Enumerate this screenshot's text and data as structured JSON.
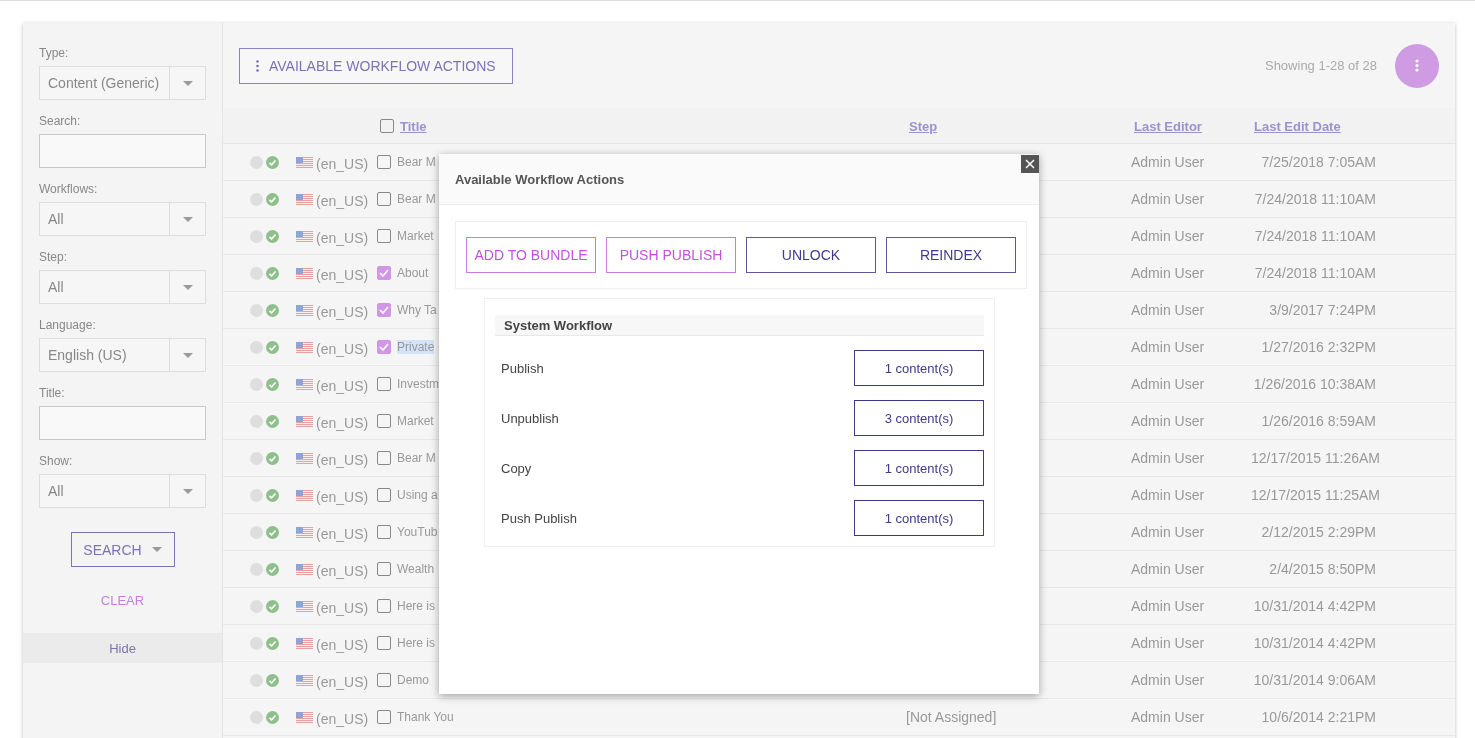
{
  "filters": [
    {
      "label": "Type:",
      "kind": "select",
      "value": "Content (Generic)"
    },
    {
      "label": "Search:",
      "kind": "text"
    },
    {
      "label": "Workflows:",
      "kind": "select",
      "value": "All"
    },
    {
      "label": "Step:",
      "kind": "select",
      "value": "All"
    },
    {
      "label": "Language:",
      "kind": "select",
      "value": "English (US)"
    },
    {
      "label": "Title:",
      "kind": "text"
    },
    {
      "label": "Show:",
      "kind": "select",
      "value": "All"
    }
  ],
  "search_button": "SEARCH",
  "clear_link": "CLEAR",
  "hide_link": "Hide",
  "toolbar": {
    "actions_button": "AVAILABLE WORKFLOW ACTIONS",
    "showing": "Showing 1-28 of 28"
  },
  "table": {
    "select_all": false,
    "columns": [
      "Title",
      "Step",
      "Last Editor",
      "Last Edit Date"
    ],
    "rows": [
      {
        "language": "(en_US)",
        "checked": false,
        "title": "Bear M",
        "editor": "Admin User",
        "date": "7/25/2018 7:05AM"
      },
      {
        "language": "(en_US)",
        "checked": false,
        "title": "Bear M",
        "editor": "Admin User",
        "date": "7/24/2018 11:10AM"
      },
      {
        "language": "(en_US)",
        "checked": false,
        "title": "Market",
        "editor": "Admin User",
        "date": "7/24/2018 11:10AM"
      },
      {
        "language": "(en_US)",
        "checked": true,
        "title": "About",
        "editor": "Admin User",
        "date": "7/24/2018 11:10AM"
      },
      {
        "language": "(en_US)",
        "checked": true,
        "title": "Why Ta",
        "editor": "Admin User",
        "date": "3/9/2017 7:24PM"
      },
      {
        "language": "(en_US)",
        "checked": true,
        "title": "Private",
        "highlighted": true,
        "editor": "Admin User",
        "date": "1/27/2016 2:32PM"
      },
      {
        "language": "(en_US)",
        "checked": false,
        "title": "Investm",
        "editor": "Admin User",
        "date": "1/26/2016 10:38AM"
      },
      {
        "language": "(en_US)",
        "checked": false,
        "title": "Market",
        "editor": "Admin User",
        "date": "1/26/2016 8:59AM"
      },
      {
        "language": "(en_US)",
        "checked": false,
        "title": "Bear M",
        "editor": "Admin User",
        "date": "12/17/2015 11:26AM"
      },
      {
        "language": "(en_US)",
        "checked": false,
        "title": "Using a",
        "editor": "Admin User",
        "date": "12/17/2015 11:25AM"
      },
      {
        "language": "(en_US)",
        "checked": false,
        "title": "YouTub",
        "editor": "Admin User",
        "date": "2/12/2015 2:29PM"
      },
      {
        "language": "(en_US)",
        "checked": false,
        "title": "Wealth",
        "editor": "Admin User",
        "date": "2/4/2015 8:50PM"
      },
      {
        "language": "(en_US)",
        "checked": false,
        "title": "Here is",
        "editor": "Admin User",
        "date": "10/31/2014 4:42PM"
      },
      {
        "language": "(en_US)",
        "checked": false,
        "title": "Here is",
        "editor": "Admin User",
        "date": "10/31/2014 4:42PM"
      },
      {
        "language": "(en_US)",
        "checked": false,
        "title": "Demo",
        "editor": "Admin User",
        "date": "10/31/2014 9:06AM"
      },
      {
        "language": "(en_US)",
        "checked": false,
        "title": "Thank You",
        "step": "[Not Assigned]",
        "editor": "Admin User",
        "date": "10/6/2014 2:21PM"
      }
    ]
  },
  "modal": {
    "title": "Available Workflow Actions",
    "actions": [
      {
        "label": "ADD TO BUNDLE",
        "kind": "accent"
      },
      {
        "label": "PUSH PUBLISH",
        "kind": "accent"
      },
      {
        "label": "UNLOCK",
        "kind": "primary"
      },
      {
        "label": "REINDEX",
        "kind": "primary"
      }
    ],
    "workflow": {
      "name": "System Workflow",
      "steps": [
        {
          "name": "Publish",
          "count": "1 content(s)"
        },
        {
          "name": "Unpublish",
          "count": "3 content(s)"
        },
        {
          "name": "Copy",
          "count": "1 content(s)"
        },
        {
          "name": "Push Publish",
          "count": "1 content(s)"
        }
      ]
    }
  }
}
